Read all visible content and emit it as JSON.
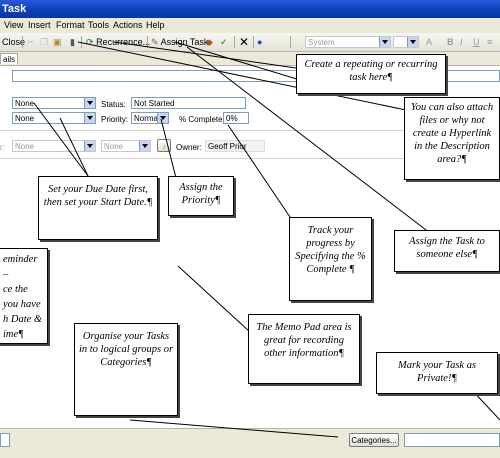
{
  "window": {
    "title": "Task"
  },
  "menu": [
    "View",
    "Insert",
    "Format",
    "Tools",
    "Actions",
    "Help"
  ],
  "toolbar": {
    "close": "Close",
    "recurrence": "Recurrence...",
    "assign_task": "Assign Task",
    "font_box": "System",
    "bold": "B",
    "italic": "I",
    "underline": "U"
  },
  "tab": {
    "details": "ails"
  },
  "form": {
    "due_date": "None",
    "start_date": "None",
    "status_label": "Status:",
    "status_value": "Not Started",
    "priority_label": "Priority:",
    "priority_value": "Normal",
    "percent_label": "% Complete:",
    "percent_value": "0%",
    "reminder_label": "r:",
    "reminder_value": "None",
    "reminder_time": "None",
    "owner_label": "Owner:",
    "owner_value": "Geoff Prior"
  },
  "bottom": {
    "categories_button": "Categories..."
  },
  "callouts": {
    "recurring": "Create a repeating or recurring task here¶",
    "attach": "You can also attach files or why not create a Hyperlink in the Description area?¶",
    "due_date": "Set your Due Date first, then set your Start Date.¶",
    "priority": "Assign the Priority¶",
    "progress": "Track your progress by Specifying the % Complete ¶",
    "assign": "Assign the Task to someone else¶",
    "reminder_1": "eminder –",
    "reminder_2": "ce the",
    "reminder_3": "you have",
    "reminder_4": "h Date &",
    "reminder_5": "ime¶",
    "memo": "The Memo Pad area is great for recording other information¶",
    "categories": "Organise your Tasks in to logical groups or Categories¶",
    "private": "Mark your Task as Private!¶"
  }
}
